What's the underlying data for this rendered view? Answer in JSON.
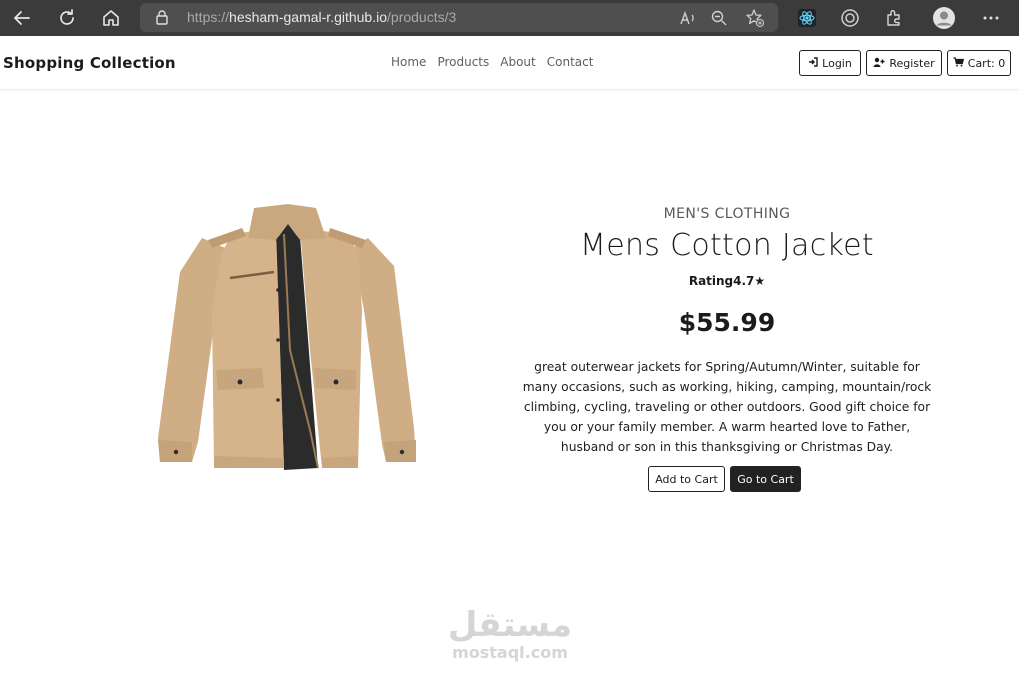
{
  "browser": {
    "url_prefix": "https://",
    "url_host": "hesham-gamal-r.github.io",
    "url_path": "/products/3",
    "icons": [
      "back-icon",
      "refresh-icon",
      "home-icon",
      "lock-icon",
      "read-aloud-icon",
      "zoom-out-icon",
      "add-favorite-icon",
      "react-devtools-icon",
      "collections-icon",
      "extensions-icon",
      "profile-icon",
      "more-icon"
    ]
  },
  "header": {
    "brand": "Shopping Collection",
    "nav": [
      "Home",
      "Products",
      "About",
      "Contact"
    ],
    "login_label": "Login",
    "register_label": "Register",
    "cart_label": "Cart: 0"
  },
  "product": {
    "category": "MEN'S CLOTHING",
    "title": "Mens Cotton Jacket",
    "rating": "Rating4.7",
    "price": "$55.99",
    "description": "great outerwear jackets for Spring/Autumn/Winter, suitable for many occasions, such as working, hiking, camping, mountain/rock climbing, cycling, traveling or other outdoors. Good gift choice for you or your family member. A warm hearted love to Father, husband or son in this thanksgiving or Christmas Day.",
    "add_to_cart_label": "Add to Cart",
    "go_to_cart_label": "Go to Cart"
  },
  "watermark": {
    "arabic": "مستقل",
    "latin": "mostaql.com"
  },
  "colors": {
    "chrome_bg": "#3b3b3b",
    "address_bar_bg": "#4f4f4f",
    "jacket": "#d2b48c",
    "dark_button": "#222222"
  }
}
